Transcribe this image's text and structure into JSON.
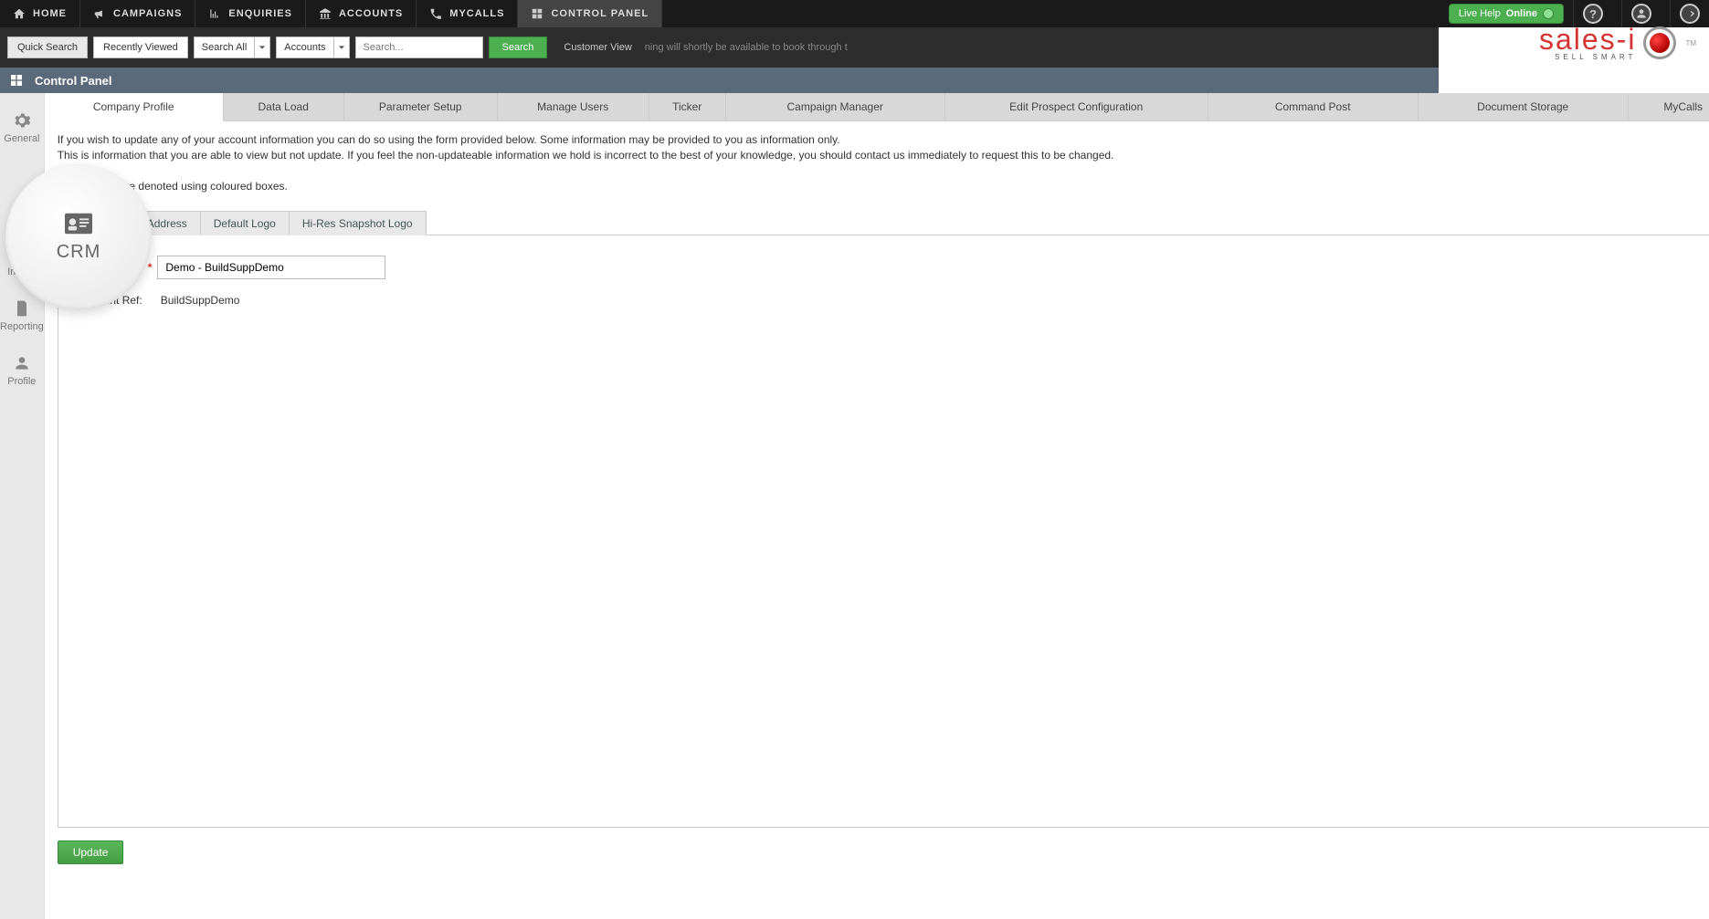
{
  "topnav": {
    "items": [
      {
        "label": "HOME"
      },
      {
        "label": "CAMPAIGNS"
      },
      {
        "label": "ENQUIRIES"
      },
      {
        "label": "ACCOUNTS"
      },
      {
        "label": "MYCALLS"
      },
      {
        "label": "CONTROL PANEL"
      }
    ]
  },
  "livehelp": {
    "text": "Live Help",
    "status": "Online"
  },
  "brand": {
    "name": "sales-i",
    "tagline": "SELL SMART",
    "tm": "TM"
  },
  "searchbar": {
    "quick_search": "Quick Search",
    "recently_viewed": "Recently Viewed",
    "search_all": "Search All",
    "accounts": "Accounts",
    "placeholder": "Search...",
    "search_btn": "Search",
    "customer_view": "Customer View",
    "ticker": "ning will shortly be available to book through t"
  },
  "titlebar": {
    "title": "Control Panel"
  },
  "sidebar": {
    "items": [
      {
        "label": "General"
      },
      {
        "label": "Import"
      },
      {
        "label": "Reporting"
      },
      {
        "label": "Profile"
      }
    ]
  },
  "crm_bubble": {
    "label": "CRM"
  },
  "main_tabs": [
    {
      "label": "Company Profile"
    },
    {
      "label": "Data Load"
    },
    {
      "label": "Parameter Setup"
    },
    {
      "label": "Manage Users"
    },
    {
      "label": "Ticker"
    },
    {
      "label": "Campaign Manager"
    },
    {
      "label": "Edit Prospect Configuration"
    },
    {
      "label": "Command Post"
    },
    {
      "label": "Document Storage"
    },
    {
      "label": "MyCalls"
    }
  ],
  "info": {
    "line1": "If you wish to update any of your account information you can do so using the form provided below. Some information may be provided to you as information only.",
    "line2": "This is information that you are able to view but not update. If you feel the non-updateable information we hold is incorrect to the best of your knowledge, you should contact us immediately to request this to be changed.",
    "mandatory": "datory fields are denoted using coloured boxes."
  },
  "subtabs": [
    {
      "label": "nt Details"
    },
    {
      "label": "Address"
    },
    {
      "label": "Default Logo"
    },
    {
      "label": "Hi-Res Snapshot Logo"
    }
  ],
  "form": {
    "client_name_label": "Client Name:",
    "client_name_value": "Demo - BuildSuppDemo",
    "account_ref_label": "Account Ref:",
    "account_ref_value": "BuildSuppDemo",
    "req_marker": "*"
  },
  "update_btn": "Update"
}
